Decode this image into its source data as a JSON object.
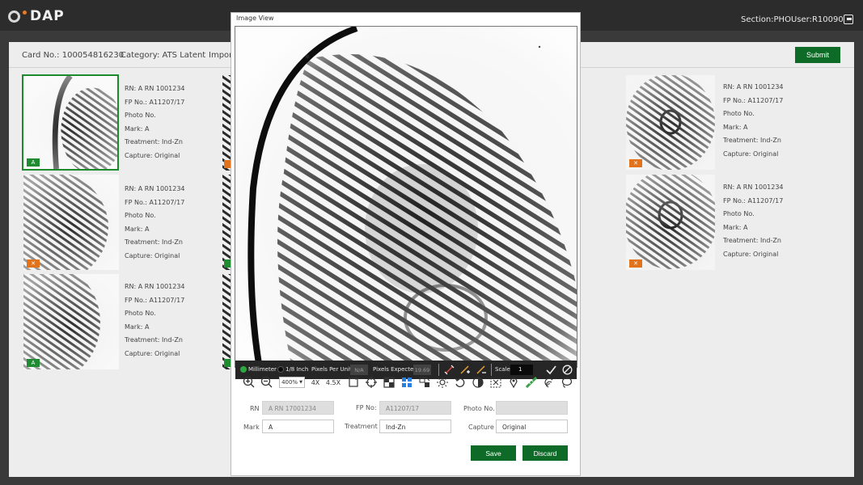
{
  "app": {
    "logo_text": "DAP",
    "section": "Section:PHO",
    "user": "User:R10090"
  },
  "header": {
    "card_no": "Card No.: 100054816230",
    "category": "Category: ATS Latent",
    "import_label": "Impor",
    "submit_label": "Submit"
  },
  "thumbnails": [
    {
      "badge": "A",
      "badge_color": "green",
      "rn": "RN:   A RN 1001234",
      "fp": "FP No.:  A11207/17",
      "photo": "Photo No.",
      "mark": "Mark:  A",
      "treatment": "Treatment:  Ind-Zn",
      "capture": "Capture:  Original"
    },
    {
      "badge": "✕",
      "badge_color": "orange",
      "rn": "RN:   A RN 1001234",
      "fp": "FP No.:  A11207/17",
      "photo": "Photo No.",
      "mark": "Mark:  A",
      "treatment": "Treatment:  Ind-Zn",
      "capture": "Capture:  Original"
    },
    {
      "badge": "A",
      "badge_color": "green",
      "rn": "RN:  A RN 1001234",
      "fp": "FP No.:  A11207/17",
      "photo": "Photo No.",
      "mark": "Mark:  A",
      "treatment": "Treatment:  Ind-Zn",
      "capture": "Capture:  Original"
    },
    {
      "badge": "✕",
      "badge_color": "orange",
      "rn": "RN:   A RN 1001234",
      "fp": "FP No.:  A11207/17",
      "photo": "Photo No.",
      "mark": "Mark:  A",
      "treatment": "Treatment:  Ind-Zn",
      "capture": "Capture:  Original"
    },
    {
      "badge": "✕",
      "badge_color": "orange",
      "rn": "RN:   A RN 1001234",
      "fp": "FP No.:  A11207/17",
      "photo": "Photo No.",
      "mark": "Mark:  A",
      "treatment": "Treatment:  Ind-Zn",
      "capture": "Capture:  Original"
    }
  ],
  "modal": {
    "title": "Image View",
    "measure": {
      "millimeter": "Millimeter",
      "eighth_inch": "1/8 Inch",
      "ppu_label": "Pixels Per Unit",
      "ppu_value": "N/A",
      "expected_label": "Pixels Expected",
      "expected_value": "19.69",
      "scale_label": "Scale",
      "scale_value": "1"
    },
    "toolbar": {
      "zoom": "400%",
      "x4": "4X",
      "x45": "4.5X"
    },
    "form": {
      "rn_label": "RN",
      "rn_value": "A RN 17001234",
      "fp_label": "FP No:",
      "fp_value": "A11207/17",
      "photo_label": "Photo No.",
      "photo_value": "",
      "mark_label": "Mark",
      "mark_value": "A",
      "treatment_label": "Treatment",
      "treatment_value": "Ind-Zn",
      "capture_label": "Capture",
      "capture_value": "Original"
    },
    "save_label": "Save",
    "discard_label": "Discard"
  },
  "colors": {
    "accent_green": "#0e6b27",
    "badge_orange": "#e0731c",
    "topbar": "#2c2c2c"
  }
}
